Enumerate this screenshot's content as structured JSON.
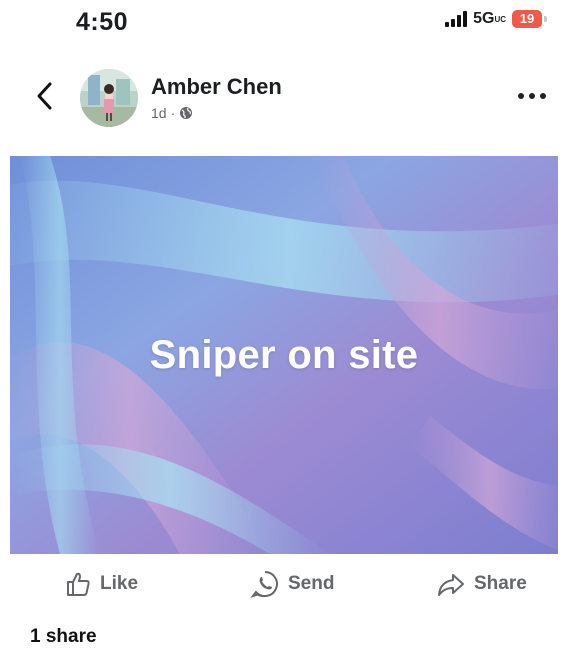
{
  "status_bar": {
    "time": "4:50",
    "network": "5G",
    "network_sup": "UC",
    "battery": "19"
  },
  "post": {
    "author": "Amber Chen",
    "age": "1d",
    "separator": "·",
    "image_text": "Sniper on site"
  },
  "actions": {
    "like": "Like",
    "send": "Send",
    "share": "Share"
  },
  "shares_count": "1 share",
  "icons": {
    "back": "chevron-left-icon",
    "globe": "globe-icon",
    "more": "more-horizontal-icon",
    "like": "thumbs-up-icon",
    "send": "whatsapp-icon",
    "share": "share-arrow-icon"
  },
  "colors": {
    "battery": "#f05a4a",
    "muted": "#65676b"
  }
}
